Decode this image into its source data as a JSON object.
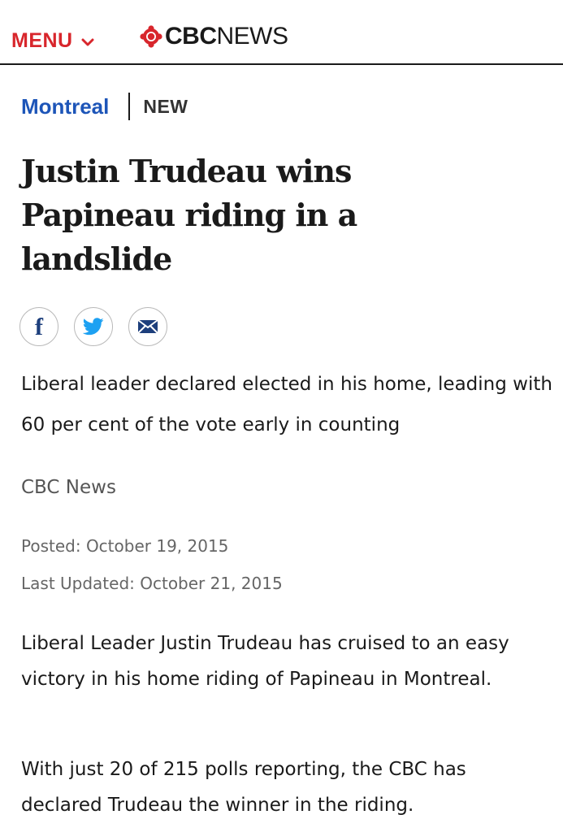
{
  "header": {
    "menu_label": "MENU",
    "logo_bold": "CBC",
    "logo_light": "NEWS"
  },
  "section": {
    "city": "Montreal",
    "tag": "NEW"
  },
  "article": {
    "headline": "Justin Trudeau wins Papineau riding in a landslide",
    "deck": "Liberal leader declared elected in his home, leading with 60 per cent of the vote early in counting",
    "byline": "CBC News",
    "posted": "Posted: October 19, 2015",
    "updated": "Last Updated: October 21, 2015",
    "paragraphs": [
      "Liberal Leader Justin Trudeau has cruised to an easy victory in his home riding of Papineau in Montreal.",
      "With just 20 of 215 polls reporting, the CBC has declared Trudeau the winner in the riding."
    ]
  },
  "share": {
    "icons": [
      "facebook-icon",
      "twitter-icon",
      "email-icon"
    ]
  },
  "colors": {
    "brand_red": "#d8262c",
    "section_blue": "#1d55b8",
    "facebook_blue": "#1d3f7c",
    "twitter_blue": "#1da1f2",
    "email_navy": "#1d3f7c"
  }
}
